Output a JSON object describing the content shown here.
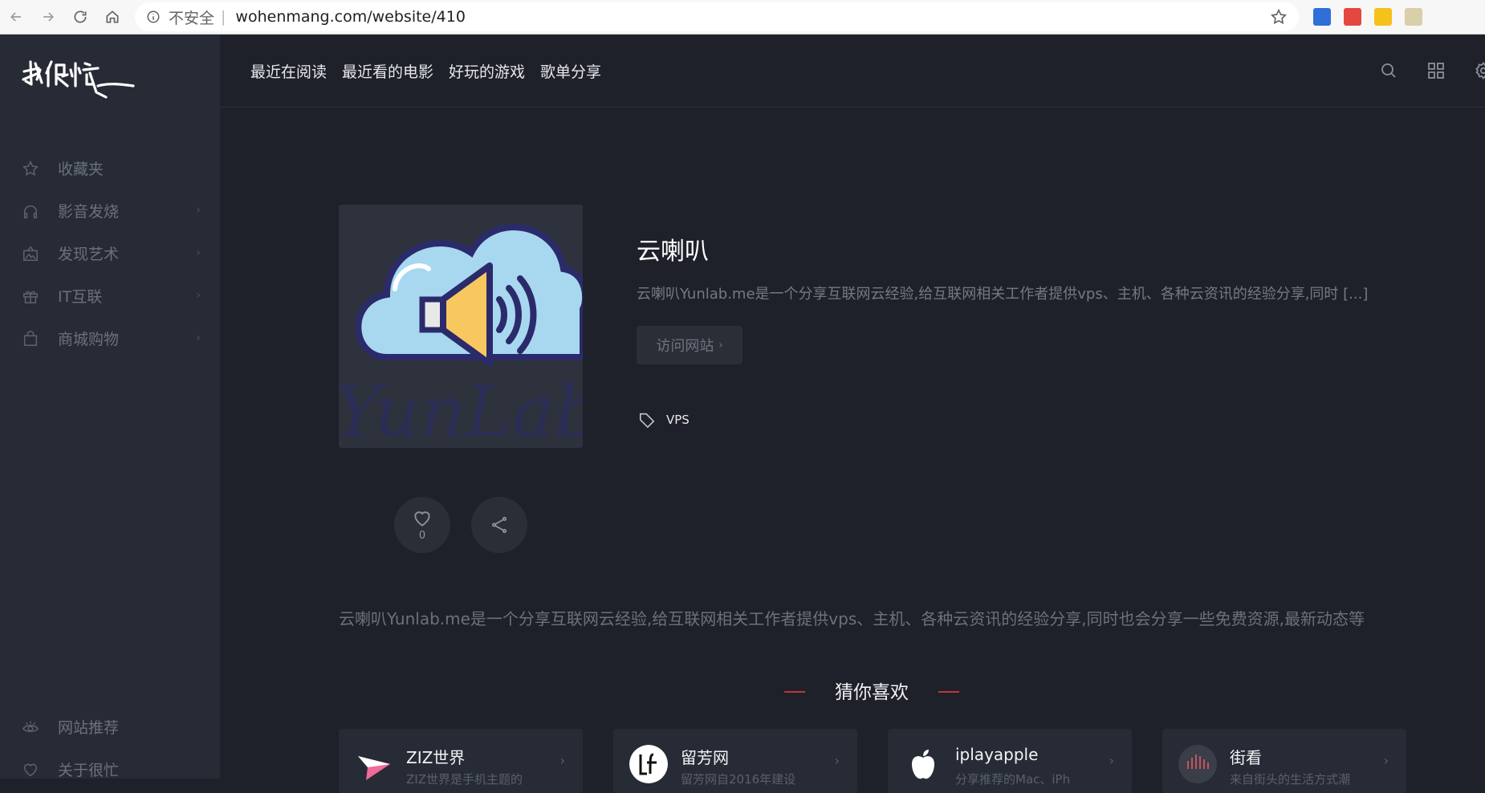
{
  "browser": {
    "security_label": "不安全",
    "url": "wohenmang.com/website/410"
  },
  "sidebar": {
    "logo_text": "我很忙",
    "items": [
      {
        "label": "收藏夹",
        "icon": "star-icon",
        "has_children": false
      },
      {
        "label": "影音发烧",
        "icon": "headphones-icon",
        "has_children": true
      },
      {
        "label": "发现艺术",
        "icon": "picture-icon",
        "has_children": true
      },
      {
        "label": "IT互联",
        "icon": "gift-icon",
        "has_children": true
      },
      {
        "label": "商城购物",
        "icon": "shopping-bag-icon",
        "has_children": true
      }
    ],
    "bottom_items": [
      {
        "label": "网站推荐",
        "icon": "eye-icon"
      },
      {
        "label": "关于很忙",
        "icon": "heart-icon"
      }
    ]
  },
  "topnav": {
    "links": [
      "最近在阅读",
      "最近看的电影",
      "好玩的游戏",
      "歌单分享"
    ]
  },
  "site": {
    "title": "云喇叭",
    "description": "云喇叭Yunlab.me是一个分享互联网云经验,给互联网相关工作者提供vps、主机、各种云资讯的经验分享,同时 [...]",
    "visit_label": "访问网站",
    "visit_arrow": "›",
    "tag": "VPS",
    "like_count": "0",
    "thumb_watermark": "YunLab",
    "long_description": "云喇叭Yunlab.me是一个分享互联网云经验,给互联网相关工作者提供vps、主机、各种云资讯的经验分享,同时也会分享一些免费资源,最新动态等"
  },
  "recommend": {
    "title": "猜你喜欢",
    "cards": [
      {
        "title": "ZIZ世界",
        "subtitle": "ZIZ世界是手机主题的",
        "icon": "paper-plane-icon"
      },
      {
        "title": "留芳网",
        "subtitle": "留芳网自2016年建设",
        "icon": "lf-logo-icon"
      },
      {
        "title": "iplayapple",
        "subtitle": "分享推荐的Mac、iPh",
        "icon": "apple-logo-icon"
      },
      {
        "title": "街看",
        "subtitle": "来自街头的生活方式潮",
        "icon": "street-logo-icon"
      }
    ]
  },
  "colors": {
    "page_bg": "#1e2129",
    "sidebar_bg": "#272b35",
    "accent_dash": "#c0353c",
    "thumb_cloud": "#a8d8f0",
    "thumb_speaker": "#f6c85f",
    "thumb_outline": "#2b2b6b"
  }
}
